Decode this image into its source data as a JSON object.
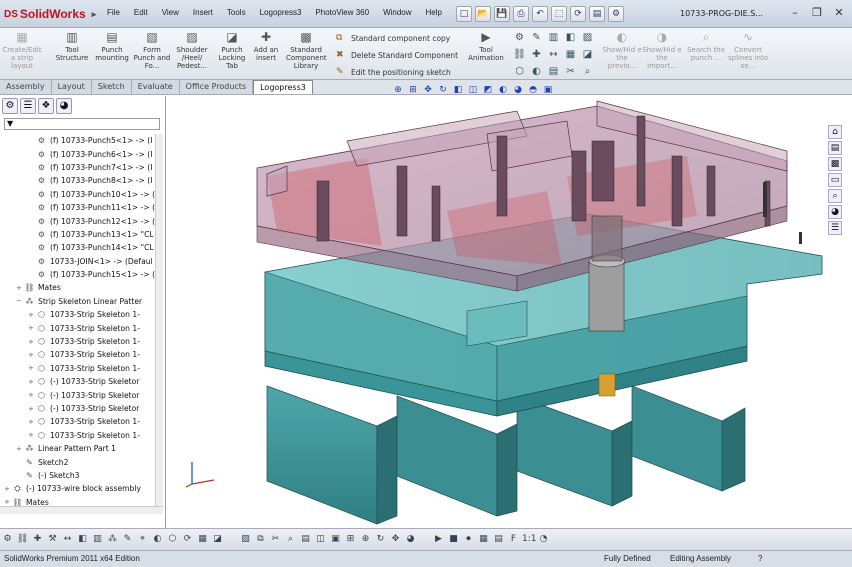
{
  "app": {
    "logo_text": "SolidWorks",
    "document_title": "10733-PROG-DIE.S..."
  },
  "menu": [
    "File",
    "Edit",
    "View",
    "Insert",
    "Tools",
    "Logopress3",
    "PhotoView 360",
    "Window",
    "Help"
  ],
  "quick_access_icons": [
    "new-icon",
    "open-icon",
    "save-icon",
    "print-icon",
    "undo-icon",
    "select-icon",
    "rebuild-icon",
    "file-properties-icon",
    "options-icon"
  ],
  "window_controls": {
    "minimize": "–",
    "restore": "❐",
    "close": "✕"
  },
  "ribbon": {
    "buttons": [
      {
        "label": "Create/Edit a strip layout",
        "icon": "strip-layout-icon",
        "dim": true
      },
      {
        "label": "Tool Structure",
        "icon": "tool-structure-icon"
      },
      {
        "label": "Punch mounting",
        "icon": "punch-mounting-icon"
      },
      {
        "label": "Form Punch and Fo...",
        "icon": "form-punch-icon"
      },
      {
        "label": "Shoulder /Heel/ Pedest...",
        "icon": "shoulder-icon"
      },
      {
        "label": "Punch Locking Tab",
        "icon": "locking-tab-icon"
      },
      {
        "label": "Add an insert",
        "icon": "insert-icon"
      },
      {
        "label": "Standard Component Library",
        "icon": "library-icon"
      }
    ],
    "list": [
      {
        "label": "Standard component copy",
        "icon": "copy-icon"
      },
      {
        "label": "Delete Standard Component",
        "icon": "delete-icon"
      },
      {
        "label": "Edit the positioning sketch",
        "icon": "sketch-icon"
      }
    ],
    "animation": {
      "label": "Tool Animation",
      "icon": "animation-icon"
    },
    "right_buttons": [
      {
        "label": "Show/Hid e the previo...",
        "icon": "show-hide-icon",
        "dim": true
      },
      {
        "label": "Show/Hid e the import...",
        "icon": "show-hide-import-icon",
        "dim": true
      },
      {
        "label": "Search the punch ...",
        "icon": "search-punch-icon",
        "dim": true
      },
      {
        "label": "Convert splines into se...",
        "icon": "convert-splines-icon",
        "dim": true
      }
    ]
  },
  "tabs": [
    "Assembly",
    "Layout",
    "Sketch",
    "Evaluate",
    "Office Products",
    "Logopress3"
  ],
  "active_tab": "Logopress3",
  "tree": [
    {
      "label": "(f) 10733-Punch5<1> -> (I",
      "icon": "part-icon",
      "indent": 2
    },
    {
      "label": "(f) 10733-Punch6<1> -> (I",
      "icon": "part-icon",
      "indent": 2
    },
    {
      "label": "(f) 10733-Punch7<1> -> (I",
      "icon": "part-icon",
      "indent": 2
    },
    {
      "label": "(f) 10733-Punch8<1> -> (I",
      "icon": "part-icon",
      "indent": 2
    },
    {
      "label": "(f) 10733-Punch10<1> -> (",
      "icon": "part-icon",
      "indent": 2
    },
    {
      "label": "(f) 10733-Punch11<1> -> (",
      "icon": "part-icon",
      "indent": 2
    },
    {
      "label": "(f) 10733-Punch12<1> -> (",
      "icon": "part-icon",
      "indent": 2
    },
    {
      "label": "(f) 10733-Punch13<1> \"CL",
      "icon": "part-icon",
      "indent": 2
    },
    {
      "label": "(f) 10733-Punch14<1> \"CL",
      "icon": "part-icon",
      "indent": 2
    },
    {
      "label": "10733-JOIN<1> -> (Defaul",
      "icon": "part-icon",
      "indent": 2
    },
    {
      "label": "(f) 10733-Punch15<1> -> (",
      "icon": "part-icon",
      "indent": 2
    },
    {
      "label": "Mates",
      "icon": "mates-icon",
      "indent": 1,
      "expander": "+"
    },
    {
      "label": "Strip Skeleton Linear Patter",
      "icon": "pattern-icon",
      "indent": 1,
      "expander": "−"
    },
    {
      "label": "10733-Strip Skeleton 1-",
      "icon": "skeleton-icon",
      "indent": 2,
      "expander": "+"
    },
    {
      "label": "10733-Strip Skeleton 1-",
      "icon": "skeleton-icon",
      "indent": 2,
      "expander": "+"
    },
    {
      "label": "10733-Strip Skeleton 1-",
      "icon": "skeleton-icon",
      "indent": 2,
      "expander": "+"
    },
    {
      "label": "10733-Strip Skeleton 1-",
      "icon": "skeleton-icon",
      "indent": 2,
      "expander": "+"
    },
    {
      "label": "10733-Strip Skeleton 1-",
      "icon": "skeleton-icon",
      "indent": 2,
      "expander": "+"
    },
    {
      "label": "(-) 10733-Strip Skeletor",
      "icon": "skeleton-icon",
      "indent": 2,
      "expander": "+"
    },
    {
      "label": "(-) 10733-Strip Skeletor",
      "icon": "skeleton-icon",
      "indent": 2,
      "expander": "+"
    },
    {
      "label": "(-) 10733-Strip Skeletor",
      "icon": "skeleton-icon",
      "indent": 2,
      "expander": "+"
    },
    {
      "label": "10733-Strip Skeleton 1-",
      "icon": "skeleton-icon",
      "indent": 2,
      "expander": "+"
    },
    {
      "label": "10733-Strip Skeleton 1-",
      "icon": "skeleton-icon",
      "indent": 2,
      "expander": "+"
    },
    {
      "label": "Linear Pattern  Part 1",
      "icon": "pattern-icon",
      "indent": 1,
      "expander": "+"
    },
    {
      "label": "Sketch2",
      "icon": "sketch-icon",
      "indent": 1
    },
    {
      "label": "(-) Sketch3",
      "icon": "sketch-icon",
      "indent": 1
    },
    {
      "label": "(-) 10733-wire block assembly",
      "icon": "assembly-icon",
      "indent": 0,
      "expander": "+"
    },
    {
      "label": "Mates",
      "icon": "mates-icon",
      "indent": 0,
      "expander": "+"
    }
  ],
  "hud_icons": [
    "zoom-fit-icon",
    "zoom-area-icon",
    "pan-icon",
    "rotate-icon",
    "section-view-icon",
    "view-orientation-icon",
    "display-style-icon",
    "hide-show-icon",
    "edit-appearance-icon",
    "apply-scene-icon",
    "view-settings-icon"
  ],
  "taskpane_icons": [
    "home-icon",
    "resources-icon",
    "library-icon",
    "file-explorer-icon",
    "search-icon",
    "appearances-icon",
    "custom-props-icon"
  ],
  "status": {
    "edition": "SolidWorks Premium 2011 x64 Edition",
    "definition": "Fully Defined",
    "mode": "Editing Assembly",
    "help": "?"
  },
  "colors": {
    "base_plate": "#58b5b7",
    "top_plate": "#b98aa5",
    "accent_red": "#c2141b"
  }
}
